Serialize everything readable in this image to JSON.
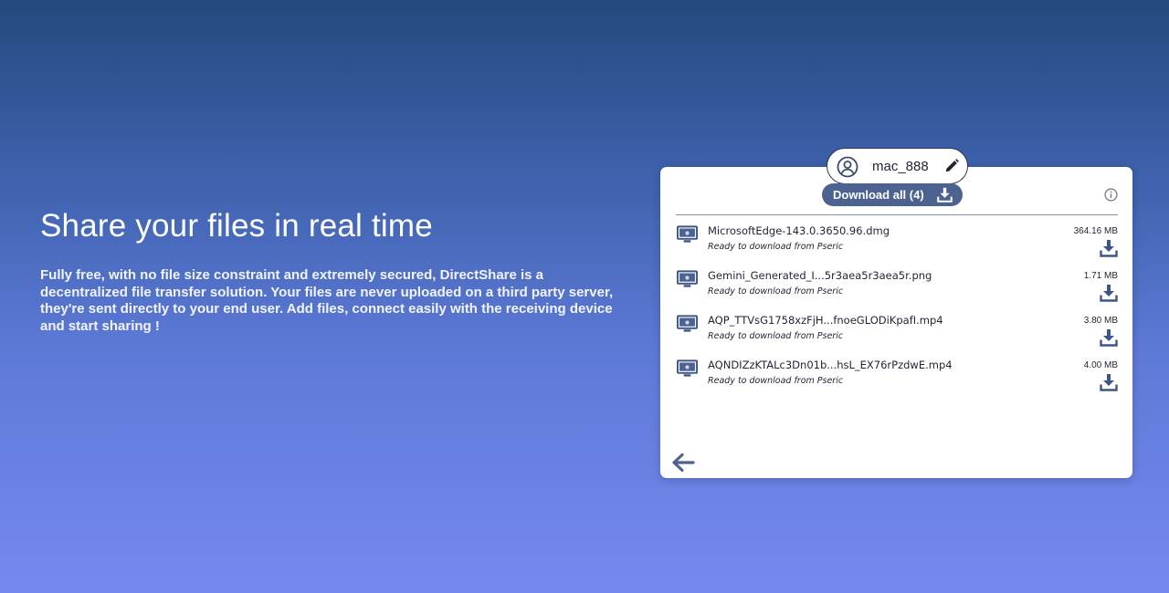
{
  "hero": {
    "title": "Share your files in real time",
    "description": "Fully free, with no file size constraint and extremely secured, DirectShare is a decentralized file transfer solution. Your files are never uploaded on a third party server, they're sent directly to your end user. Add files, connect easily with the receiving device and start sharing !"
  },
  "panel": {
    "username": "mac_888",
    "download_all_label": "Download all (4)",
    "files": [
      {
        "name": "MicrosoftEdge-143.0.3650.96.dmg",
        "status": "Ready to download from Pseric",
        "size": "364.16 MB"
      },
      {
        "name": "Gemini_Generated_I...5r3aea5r3aea5r.png",
        "status": "Ready to download from Pseric",
        "size": "1.71 MB"
      },
      {
        "name": "AQP_TTVsG1758xzFjH...fnoeGLODiKpafI.mp4",
        "status": "Ready to download from Pseric",
        "size": "3.80 MB"
      },
      {
        "name": "AQNDIZzKTALc3Dn01b...hsL_EX76rPzdwE.mp4",
        "status": "Ready to download from Pseric",
        "size": "4.00 MB"
      }
    ]
  },
  "icons": {
    "avatar": "user-circle-icon",
    "edit": "pencil-icon",
    "download_all": "download-icon",
    "info": "info-icon",
    "device": "monitor-apple-icon",
    "download": "download-icon",
    "back": "arrow-left-icon"
  },
  "colors": {
    "accent": "#4c6391",
    "icon_blue": "#3d5688",
    "background_top": "#23497e",
    "background_bottom": "#7688ef"
  }
}
